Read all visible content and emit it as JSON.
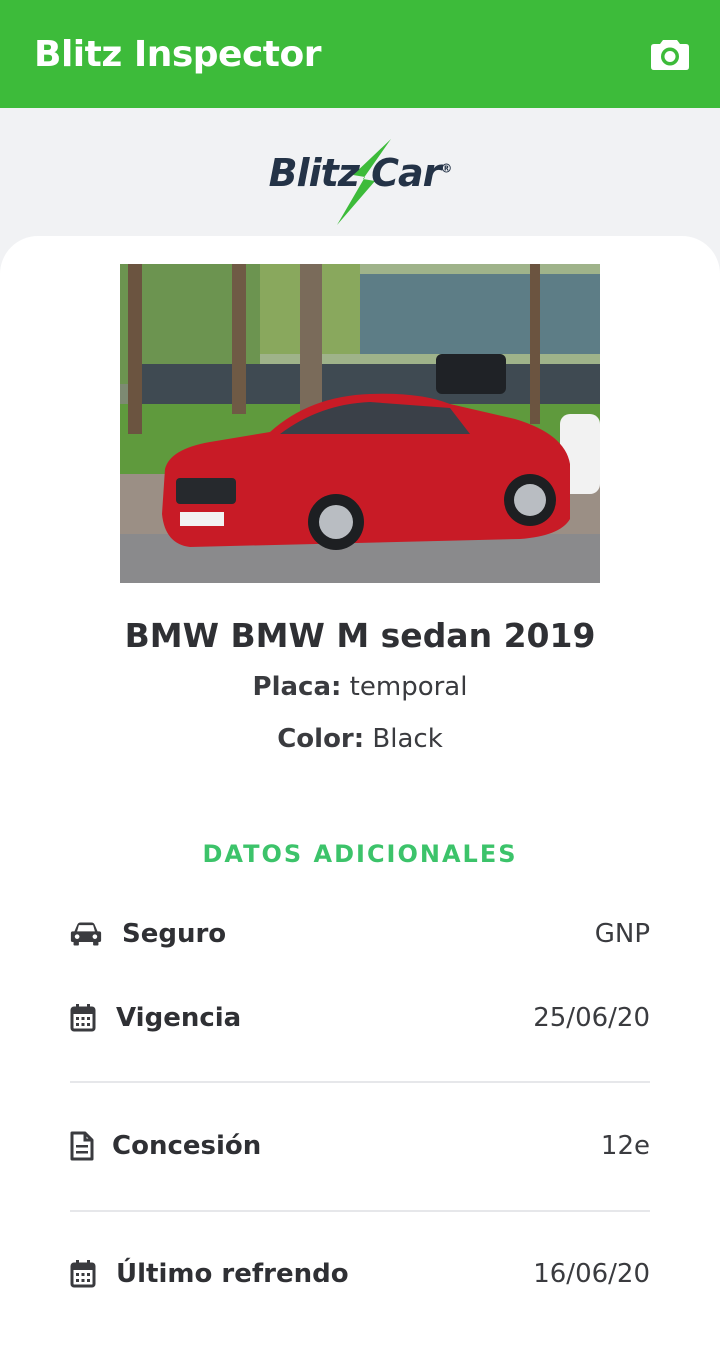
{
  "appbar": {
    "title": "Blitz Inspector",
    "camera_icon": "camera-icon",
    "color": "#3dbb3a"
  },
  "logo": {
    "text": "Blitz Car",
    "brand_dark": "#243347",
    "brand_green": "#3dbb3a"
  },
  "vehicle": {
    "title": "BMW BMW M sedan 2019",
    "plate_label": "Placa:",
    "plate_value": "temporal",
    "color_label": "Color:",
    "color_value": "Black"
  },
  "additional": {
    "section_title": "DATOS ADICIONALES",
    "accent": "#3cc36a",
    "rows": [
      {
        "icon": "car-icon",
        "label": "Seguro",
        "value": "GNP"
      },
      {
        "icon": "calendar-icon",
        "label": "Vigencia",
        "value": "25/06/20"
      },
      {
        "icon": "document-icon",
        "label": "Concesión",
        "value": "12e"
      },
      {
        "icon": "calendar-icon",
        "label": "Último refrendo",
        "value": "16/06/20"
      }
    ]
  }
}
